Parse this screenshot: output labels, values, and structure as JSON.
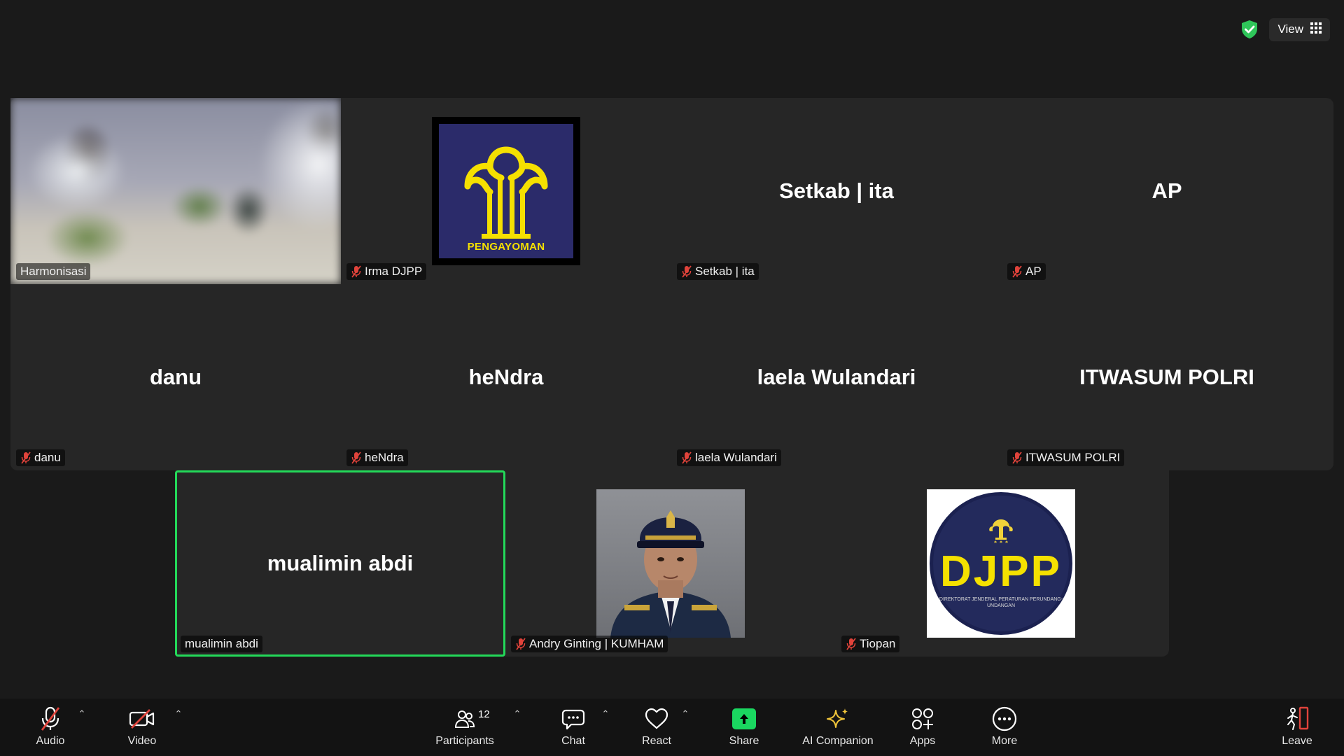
{
  "top_bar": {
    "view_label": "View",
    "security_icon": "shield-check-icon",
    "view_icon": "grid-icon"
  },
  "gallery": {
    "tiles": [
      {
        "name": "Harmonisasi",
        "type": "video",
        "muted": false
      },
      {
        "name": "Irma DJPP",
        "type": "avatar-pengayoman",
        "avatar_text": "PENGAYOMAN",
        "muted": true
      },
      {
        "name": "Setkab | ita",
        "type": "name",
        "muted": true
      },
      {
        "name": "AP",
        "type": "name",
        "muted": true
      },
      {
        "name": "danu",
        "type": "name",
        "muted": true
      },
      {
        "name": "heNdra",
        "type": "name",
        "muted": true
      },
      {
        "name": "laela Wulandari",
        "type": "name",
        "muted": true
      },
      {
        "name": "ITWASUM POLRI",
        "type": "name",
        "muted": true
      },
      {
        "name": "mualimin abdi",
        "type": "name",
        "muted": false,
        "active_speaker": true
      },
      {
        "name": "Andry Ginting | KUMHAM",
        "type": "avatar-photo",
        "muted": true
      },
      {
        "name": "Tiopan",
        "type": "avatar-djpp",
        "avatar_text": "DJPP",
        "muted": true
      }
    ],
    "djpp_subtext": "DIREKTORAT JENDERAL PERATURAN PERUNDANG-UNDANGAN"
  },
  "toolbar": {
    "audio": "Audio",
    "video": "Video",
    "participants": "Participants",
    "participants_count": "12",
    "chat": "Chat",
    "react": "React",
    "share": "Share",
    "ai_companion": "AI Companion",
    "apps": "Apps",
    "more": "More",
    "leave": "Leave"
  },
  "colors": {
    "background": "#1a1a1a",
    "tile": "#262626",
    "active_speaker": "#23d959",
    "muted_icon": "#e0433b",
    "share": "#1ad760",
    "leave": "#e0433b"
  }
}
